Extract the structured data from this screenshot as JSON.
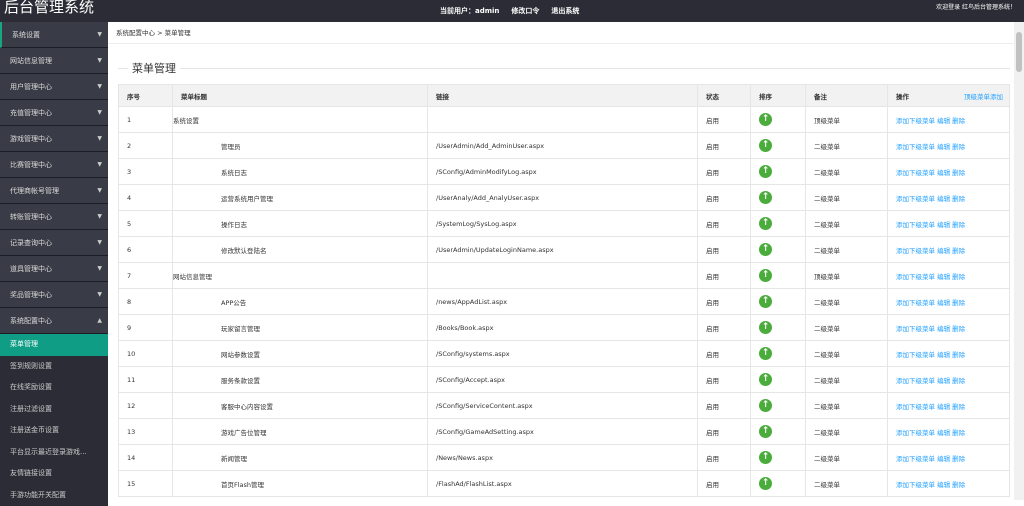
{
  "header": {
    "logo": "后台管理系统",
    "current_user": "当前用户：admin",
    "change_password": "修改口令",
    "logout": "退出系统",
    "welcome": "欢迎登录 红鸟后台管理系统！"
  },
  "sidebar": {
    "items": [
      {
        "label": "系统设置"
      },
      {
        "label": "网站信息管理"
      },
      {
        "label": "用户管理中心"
      },
      {
        "label": "充值管理中心"
      },
      {
        "label": "游戏管理中心"
      },
      {
        "label": "比赛管理中心"
      },
      {
        "label": "代理商帐号管理"
      },
      {
        "label": "转账管理中心"
      },
      {
        "label": "记录查询中心"
      },
      {
        "label": "道具管理中心"
      },
      {
        "label": "奖品管理中心"
      },
      {
        "label": "系统配置中心"
      }
    ],
    "subitems": [
      {
        "label": "菜单管理"
      },
      {
        "label": "签到规则设置"
      },
      {
        "label": "在线奖励设置"
      },
      {
        "label": "注册过滤设置"
      },
      {
        "label": "注册送金币设置"
      },
      {
        "label": "平台显示最近登录游戏..."
      },
      {
        "label": "友情链接设置"
      },
      {
        "label": "手游功能开关配置"
      }
    ]
  },
  "breadcrumb": "系统配置中心 > 菜单管理",
  "page_title": "菜单管理",
  "table": {
    "headers": [
      "序号",
      "菜单标题",
      "链接",
      "状态",
      "排序",
      "备注",
      "操作"
    ],
    "top_add": "顶级菜单添加",
    "actions": {
      "add": "添加下级菜单",
      "edit": "编辑",
      "delete": "删除"
    },
    "rows": [
      {
        "no": "1",
        "title": "系统设置",
        "link": "",
        "status": "启用",
        "note": "顶级菜单",
        "level": 1
      },
      {
        "no": "2",
        "title": "管理员",
        "link": "/UserAdmin/Add_AdminUser.aspx",
        "status": "启用",
        "note": "二级菜单",
        "level": 2
      },
      {
        "no": "3",
        "title": "系统日志",
        "link": "/SConfig/AdminModifyLog.aspx",
        "status": "启用",
        "note": "二级菜单",
        "level": 2
      },
      {
        "no": "4",
        "title": "运营系统用户管理",
        "link": "/UserAnaly/Add_AnalyUser.aspx",
        "status": "启用",
        "note": "二级菜单",
        "level": 2
      },
      {
        "no": "5",
        "title": "操作日志",
        "link": "/SystemLog/SysLog.aspx",
        "status": "启用",
        "note": "二级菜单",
        "level": 2
      },
      {
        "no": "6",
        "title": "修改默认登陆名",
        "link": "/UserAdmin/UpdateLoginName.aspx",
        "status": "启用",
        "note": "二级菜单",
        "level": 2
      },
      {
        "no": "7",
        "title": "网站信息管理",
        "link": "",
        "status": "启用",
        "note": "顶级菜单",
        "level": 1
      },
      {
        "no": "8",
        "title": "APP公告",
        "link": "/news/AppAdList.aspx",
        "status": "启用",
        "note": "二级菜单",
        "level": 2
      },
      {
        "no": "9",
        "title": "玩家留言管理",
        "link": "/Books/Book.aspx",
        "status": "启用",
        "note": "二级菜单",
        "level": 2
      },
      {
        "no": "10",
        "title": "网站参数设置",
        "link": "/SConfig/systems.aspx",
        "status": "启用",
        "note": "二级菜单",
        "level": 2
      },
      {
        "no": "11",
        "title": "服务条款设置",
        "link": "/SConfig/Accept.aspx",
        "status": "启用",
        "note": "二级菜单",
        "level": 2
      },
      {
        "no": "12",
        "title": "客服中心内容设置",
        "link": "/SConfig/ServiceContent.aspx",
        "status": "启用",
        "note": "二级菜单",
        "level": 2
      },
      {
        "no": "13",
        "title": "游戏广告位管理",
        "link": "/SConfig/GameAdSetting.aspx",
        "status": "启用",
        "note": "二级菜单",
        "level": 2
      },
      {
        "no": "14",
        "title": "新闻管理",
        "link": "/News/News.aspx",
        "status": "启用",
        "note": "二级菜单",
        "level": 2
      },
      {
        "no": "15",
        "title": "首页Flash管理",
        "link": "/FlashAd/FlashList.aspx",
        "status": "启用",
        "note": "二级菜单",
        "level": 2
      }
    ]
  },
  "colors": {
    "accent": "#109d86",
    "link": "#1e9fff",
    "sort_icon": "#4aac3a",
    "header_bg": "#2b2c35"
  }
}
